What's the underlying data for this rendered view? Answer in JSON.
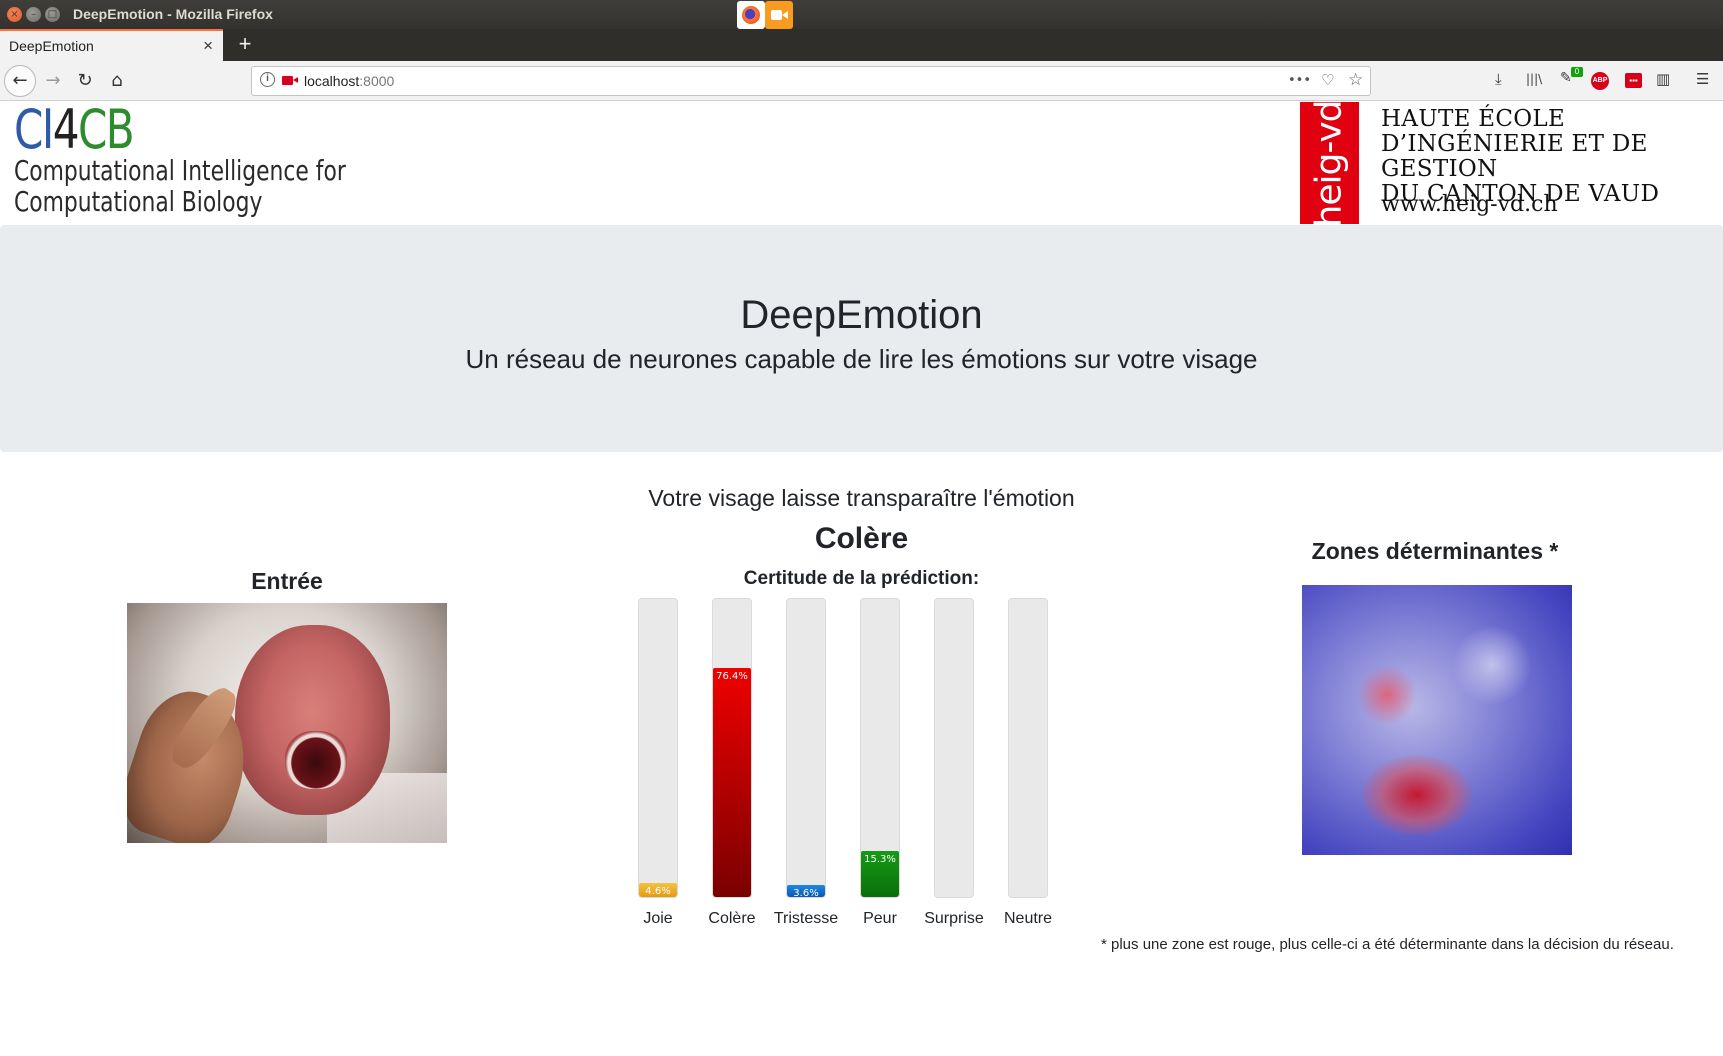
{
  "window": {
    "title": "DeepEmotion - Mozilla Firefox",
    "buttons": {
      "close": "×",
      "minimize": "–",
      "maximize": "□"
    }
  },
  "browser": {
    "tab_title": "DeepEmotion",
    "tab_close": "×",
    "new_tab": "+",
    "url_host": "localhost",
    "url_port": ":8000",
    "nav": {
      "back": "←",
      "forward": "→",
      "reload": "↻",
      "home": "⌂"
    },
    "url_actions": {
      "more": "•••",
      "pocket": "♡",
      "bookmark": "☆"
    },
    "toolbar": {
      "download": "⤓",
      "library": "|||\\",
      "sync_badge": "0",
      "abp": "ABP",
      "ext_red": "▪▪▪",
      "sidebar": "▥",
      "menu": "☰"
    },
    "icons": [
      "info-icon",
      "camera-icon",
      "download-icon",
      "library-icon",
      "adblock-icon",
      "sidebar-icon",
      "menu-icon"
    ]
  },
  "header": {
    "logo_left": {
      "c": "CI",
      "four": "4",
      "cb": "CB",
      "line1": "Computational Intelligence for",
      "line2": "Computational Biology"
    },
    "logo_right": {
      "vertical": "heig-vd",
      "line1": "HAUTE ÉCOLE",
      "line2": "D’INGÉNIERIE ET DE GESTION",
      "line3": "DU CANTON DE VAUD",
      "url": "www.heig-vd.ch"
    }
  },
  "hero": {
    "title": "DeepEmotion",
    "subtitle": "Un réseau de neurones capable de lire les émotions sur votre visage"
  },
  "input_panel": {
    "title": "Entrée"
  },
  "prediction": {
    "intro": "Votre visage laisse transparaître l'émotion",
    "emotion": "Colère",
    "certitude_label": "Certitude de la prédiction:"
  },
  "chart_data": {
    "type": "bar",
    "categories": [
      "Joie",
      "Colère",
      "Tristesse",
      "Peur",
      "Surprise",
      "Neutre"
    ],
    "values": [
      4.6,
      76.4,
      3.6,
      15.3,
      0,
      0
    ],
    "value_labels": [
      "4.6%",
      "76.4%",
      "3.6%",
      "15.3%",
      "",
      ""
    ],
    "ylim": [
      0,
      100
    ],
    "colors": [
      "#f0a81c",
      "#cc0000",
      "#0b6fd0",
      "#108a10",
      "#e9e9e9",
      "#e9e9e9"
    ]
  },
  "zones_panel": {
    "title": "Zones déterminantes *",
    "footnote": "* plus une zone est rouge, plus celle-ci a été déterminante dans la décision du réseau."
  }
}
